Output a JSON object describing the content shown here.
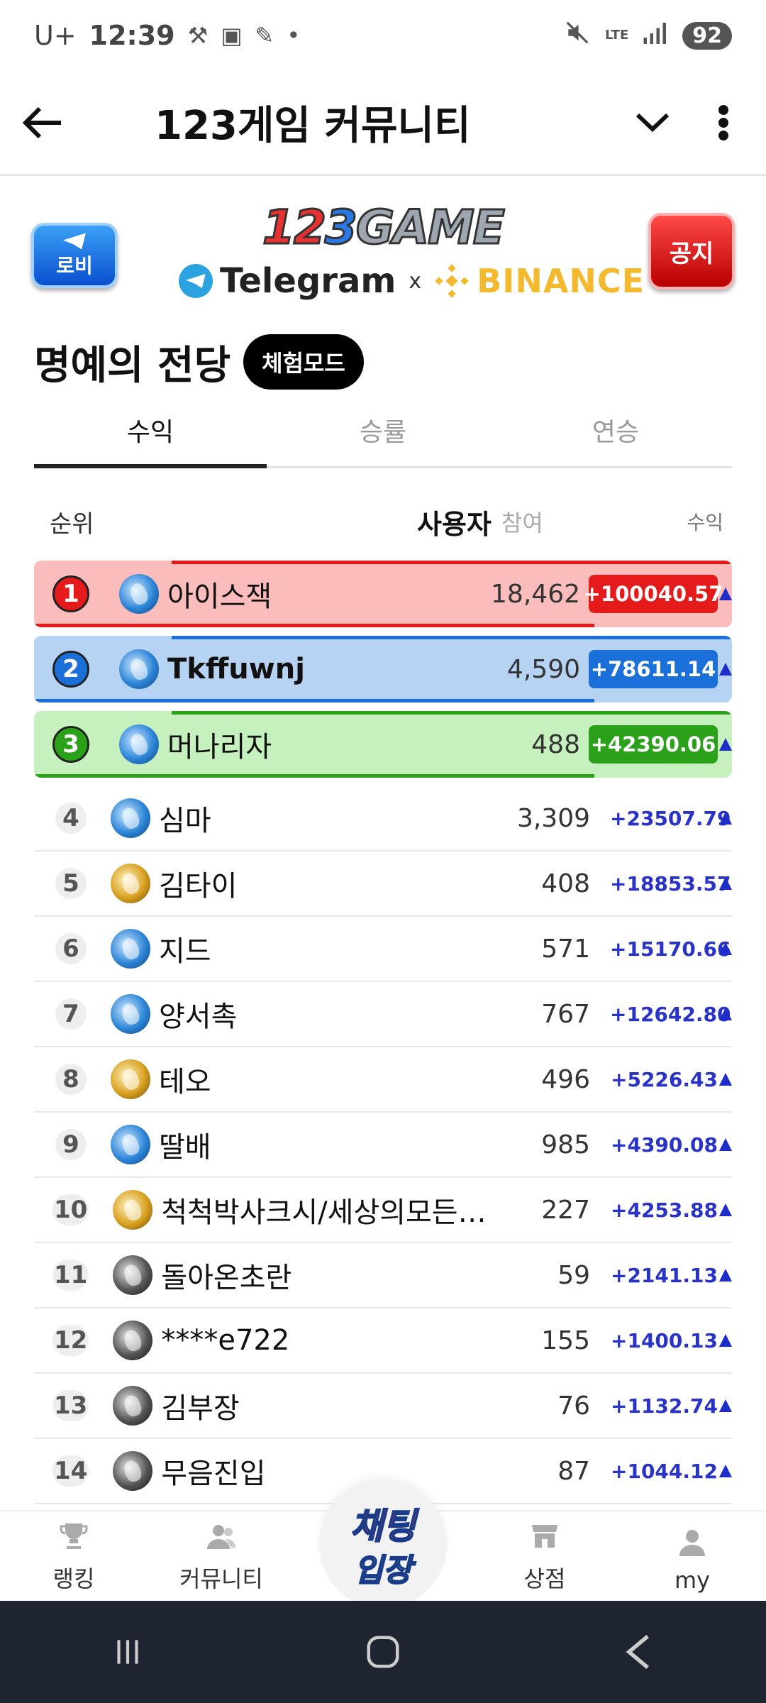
{
  "status_bar": {
    "carrier": "U+",
    "time": "12:39",
    "network": "LTE",
    "battery": "92"
  },
  "app_bar": {
    "title": "123게임 커뮤니티"
  },
  "banner": {
    "lobby_label": "로비",
    "notice_label": "공지",
    "logo_digits": [
      "1",
      "2",
      "3"
    ],
    "logo_word": "GAME",
    "telegram": "Telegram",
    "x": "x",
    "binance": "BINANCE"
  },
  "hall_of_fame": {
    "title": "명예의 전당",
    "mode_badge": "체험모드"
  },
  "tabs": [
    {
      "label": "수익",
      "active": true
    },
    {
      "label": "승률",
      "active": false
    },
    {
      "label": "연승",
      "active": false
    }
  ],
  "columns": {
    "rank": "순위",
    "user": "사용자",
    "participation": "참여",
    "profit": "수익"
  },
  "top3": [
    {
      "rank": "1",
      "name": "아이스잭",
      "participation": "18,462",
      "profit": "+100040.57",
      "avatar": "blue"
    },
    {
      "rank": "2",
      "name": "Tkffuwnj",
      "participation": "4,590",
      "profit": "+78611.14",
      "avatar": "blue"
    },
    {
      "rank": "3",
      "name": "머나리자",
      "participation": "488",
      "profit": "+42390.06",
      "avatar": "blue"
    }
  ],
  "rows": [
    {
      "rank": "4",
      "name": "심마",
      "participation": "3,309",
      "profit": "+23507.79",
      "avatar": "blue"
    },
    {
      "rank": "5",
      "name": "김타이",
      "participation": "408",
      "profit": "+18853.57",
      "avatar": "gold"
    },
    {
      "rank": "6",
      "name": "지드",
      "participation": "571",
      "profit": "+15170.66",
      "avatar": "blue"
    },
    {
      "rank": "7",
      "name": "양서촉",
      "participation": "767",
      "profit": "+12642.80",
      "avatar": "blue"
    },
    {
      "rank": "8",
      "name": "테오",
      "participation": "496",
      "profit": "+5226.43",
      "avatar": "gold"
    },
    {
      "rank": "9",
      "name": "딸배",
      "participation": "985",
      "profit": "+4390.08",
      "avatar": "blue"
    },
    {
      "rank": "10",
      "name": "척척박사크시/세상의모든…",
      "participation": "227",
      "profit": "+4253.88",
      "avatar": "gold"
    },
    {
      "rank": "11",
      "name": "돌아온초란",
      "participation": "59",
      "profit": "+2141.13",
      "avatar": "dark"
    },
    {
      "rank": "12",
      "name": "****e722",
      "participation": "155",
      "profit": "+1400.13",
      "avatar": "dark"
    },
    {
      "rank": "13",
      "name": "김부장",
      "participation": "76",
      "profit": "+1132.74",
      "avatar": "dark"
    },
    {
      "rank": "14",
      "name": "무음진입",
      "participation": "87",
      "profit": "+1044.12",
      "avatar": "dark"
    }
  ],
  "bottom_nav": {
    "ranking": "랭킹",
    "community": "커뮤니티",
    "chat_line1": "채팅",
    "chat_line2": "입장",
    "shop": "상점",
    "my": "my"
  },
  "colors": {
    "rank1_bg": "#fbbcbc",
    "rank1_accent": "#e51b1b",
    "rank2_bg": "#b7d3f3",
    "rank2_accent": "#1a6fd8",
    "rank3_bg": "#c6f0bd",
    "rank3_accent": "#2ba11a",
    "profit_text": "#2a33c8"
  }
}
